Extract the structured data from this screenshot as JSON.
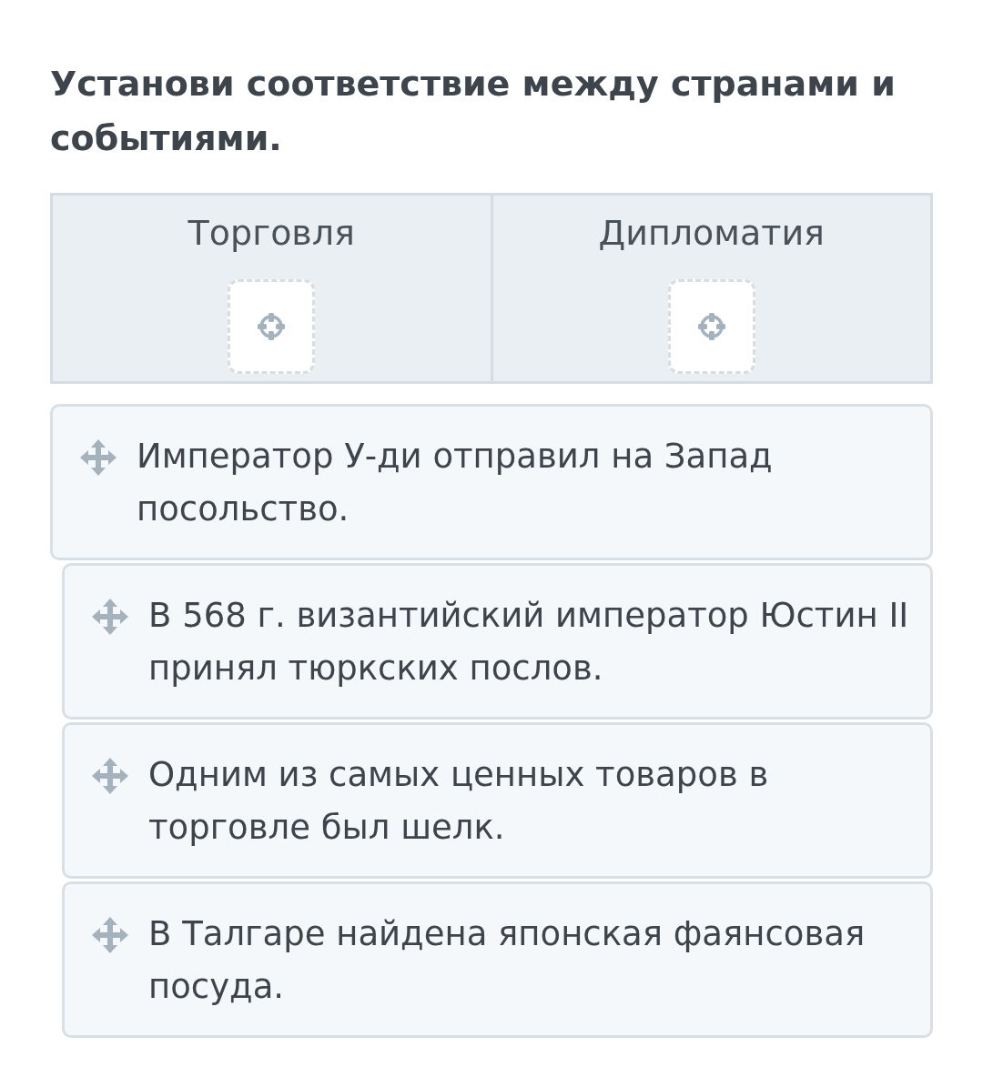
{
  "title": "Установи соответствие между странами и событиями.",
  "columns": [
    {
      "label": "Торговля"
    },
    {
      "label": "Дипломатия"
    }
  ],
  "cards": [
    {
      "text": "Император У-ди отправил на Запад посольство.",
      "indented": false
    },
    {
      "text": "В 568 г. византийский император Юстин II принял тюркских послов.",
      "indented": true
    },
    {
      "text": "Одним из самых ценных товаров в торговле был шелк.",
      "indented": true
    },
    {
      "text": "В Талгаре найдена японская фаянсовая посуда.",
      "indented": true
    }
  ]
}
